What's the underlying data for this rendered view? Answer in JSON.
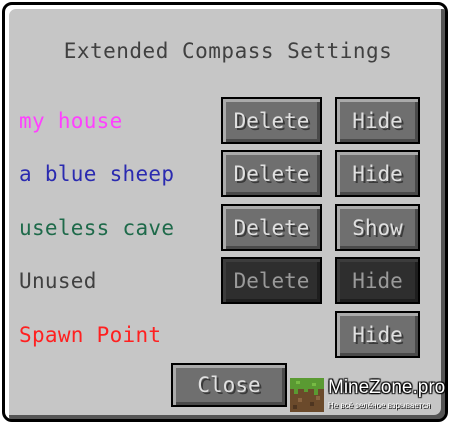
{
  "title": "Extended Compass Settings",
  "rows": [
    {
      "label": "my house",
      "color": "#ff40ff",
      "delete": "Delete",
      "toggle": "Hide"
    },
    {
      "label": "a blue sheep",
      "color": "#2a2ab0",
      "delete": "Delete",
      "toggle": "Hide"
    },
    {
      "label": "useless cave",
      "color": "#1e6a4a",
      "delete": "Delete",
      "toggle": "Show"
    },
    {
      "label": "Unused",
      "color": "#404040",
      "delete": "Delete",
      "toggle": "Hide",
      "disabled": true
    },
    {
      "label": "Spawn Point",
      "color": "#ff2020",
      "toggle": "Hide"
    }
  ],
  "close_label": "Close",
  "watermark": {
    "name": "MineZone.pro",
    "tagline": "Не всё зелёное взрывается"
  },
  "colors": {
    "panel": "#c6c6c6",
    "button": "#6f6f6f",
    "button_disabled": "#2e2e2e"
  },
  "icons": [
    "grass-block-icon"
  ]
}
